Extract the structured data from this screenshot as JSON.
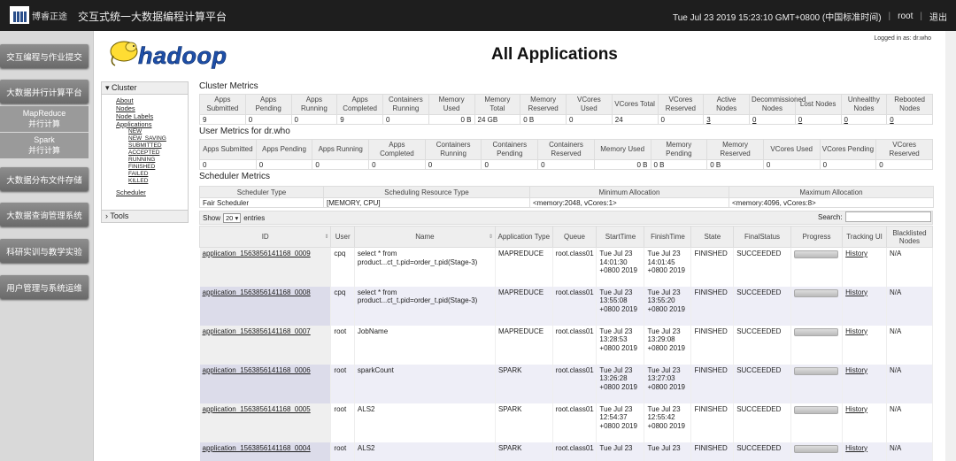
{
  "topbar": {
    "logo_text": "博睿正途",
    "system_title": "交互式统一大数据编程计算平台",
    "datetime": "Tue Jul 23 2019 15:23:10 GMT+0800 (中国标准时间)",
    "user": "root",
    "logout": "退出"
  },
  "sidenav": {
    "items": [
      {
        "label": "交互编程与作业提交"
      },
      {
        "label": "大数据并行计算平台"
      },
      {
        "label": "大数据分布文件存储"
      },
      {
        "label": "大数据查询管理系统"
      },
      {
        "label": "科研实训与教学实验"
      },
      {
        "label": "用户管理与系统运维"
      }
    ],
    "sub": [
      {
        "line1": "MapReduce",
        "line2": "并行计算"
      },
      {
        "line1": "Spark",
        "line2": "并行计算"
      }
    ]
  },
  "header": {
    "logo_alt": "hadoop",
    "title": "All Applications",
    "logged_in": "Logged in as: dr.who"
  },
  "menu": {
    "cluster": "Cluster",
    "links": [
      "About",
      "Nodes",
      "Node Labels",
      "Applications"
    ],
    "states": [
      "NEW",
      "NEW_SAVING",
      "SUBMITTED",
      "ACCEPTED",
      "RUNNING",
      "FINISHED",
      "FAILED",
      "KILLED"
    ],
    "scheduler": "Scheduler",
    "tools": "Tools"
  },
  "cluster_metrics": {
    "title": "Cluster Metrics",
    "headers": [
      "Apps Submitted",
      "Apps Pending",
      "Apps Running",
      "Apps Completed",
      "Containers Running",
      "Memory Used",
      "Memory Total",
      "Memory Reserved",
      "VCores Used",
      "VCores Total",
      "VCores Reserved",
      "Active Nodes",
      "Decommissioned Nodes",
      "Lost Nodes",
      "Unhealthy Nodes",
      "Rebooted Nodes"
    ],
    "values": [
      "9",
      "0",
      "0",
      "9",
      "0",
      "0 B",
      "24 GB",
      "0 B",
      "0",
      "24",
      "0",
      "3",
      "0",
      "0",
      "0",
      "0"
    ]
  },
  "user_metrics": {
    "title": "User Metrics for dr.who",
    "headers": [
      "Apps Submitted",
      "Apps Pending",
      "Apps Running",
      "Apps Completed",
      "Containers Running",
      "Containers Pending",
      "Containers Reserved",
      "Memory Used",
      "Memory Pending",
      "Memory Reserved",
      "VCores Used",
      "VCores Pending",
      "VCores Reserved"
    ],
    "values": [
      "0",
      "0",
      "0",
      "0",
      "0",
      "0",
      "0",
      "0 B",
      "0 B",
      "0 B",
      "0",
      "0",
      "0"
    ]
  },
  "scheduler_metrics": {
    "title": "Scheduler Metrics",
    "headers": [
      "Scheduler Type",
      "Scheduling Resource Type",
      "Minimum Allocation",
      "Maximum Allocation"
    ],
    "values": [
      "Fair Scheduler",
      "[MEMORY, CPU]",
      "<memory:2048, vCores:1>",
      "<memory:4096, vCores:8>"
    ]
  },
  "table_controls": {
    "show": "Show",
    "entries_value": "20",
    "entries": "entries",
    "search": "Search:"
  },
  "apps": {
    "headers": [
      "ID",
      "User",
      "Name",
      "Application Type",
      "Queue",
      "StartTime",
      "FinishTime",
      "State",
      "FinalStatus",
      "Progress",
      "Tracking UI",
      "Blacklisted Nodes"
    ],
    "rows": [
      {
        "id": "application_1563856141168_0009",
        "user": "cpq",
        "name": "select * from product...ct_t.pid=order_t.pid(Stage-3)",
        "type": "MAPREDUCE",
        "queue": "root.class01",
        "start": "Tue Jul 23 14:01:30 +0800 2019",
        "finish": "Tue Jul 23 14:01:45 +0800 2019",
        "state": "FINISHED",
        "final": "SUCCEEDED",
        "progress": 1.0,
        "tracking": "History",
        "blacklisted": "N/A"
      },
      {
        "id": "application_1563856141168_0008",
        "user": "cpq",
        "name": "select * from product...ct_t.pid=order_t.pid(Stage-3)",
        "type": "MAPREDUCE",
        "queue": "root.class01",
        "start": "Tue Jul 23 13:55:08 +0800 2019",
        "finish": "Tue Jul 23 13:55:20 +0800 2019",
        "state": "FINISHED",
        "final": "SUCCEEDED",
        "progress": 1.0,
        "tracking": "History",
        "blacklisted": "N/A"
      },
      {
        "id": "application_1563856141168_0007",
        "user": "root",
        "name": "JobName",
        "type": "MAPREDUCE",
        "queue": "root.class01",
        "start": "Tue Jul 23 13:28:53 +0800 2019",
        "finish": "Tue Jul 23 13:29:08 +0800 2019",
        "state": "FINISHED",
        "final": "SUCCEEDED",
        "progress": 1.0,
        "tracking": "History",
        "blacklisted": "N/A"
      },
      {
        "id": "application_1563856141168_0006",
        "user": "root",
        "name": "sparkCount",
        "type": "SPARK",
        "queue": "root.class01",
        "start": "Tue Jul 23 13:26:28 +0800 2019",
        "finish": "Tue Jul 23 13:27:03 +0800 2019",
        "state": "FINISHED",
        "final": "SUCCEEDED",
        "progress": 1.0,
        "tracking": "History",
        "blacklisted": "N/A"
      },
      {
        "id": "application_1563856141168_0005",
        "user": "root",
        "name": "ALS2",
        "type": "SPARK",
        "queue": "root.class01",
        "start": "Tue Jul 23 12:54:37 +0800 2019",
        "finish": "Tue Jul 23 12:55:42 +0800 2019",
        "state": "FINISHED",
        "final": "SUCCEEDED",
        "progress": 1.0,
        "tracking": "History",
        "blacklisted": "N/A"
      },
      {
        "id": "application_1563856141168_0004",
        "user": "root",
        "name": "ALS2",
        "type": "SPARK",
        "queue": "root.class01",
        "start": "Tue Jul 23",
        "finish": "Tue Jul 23",
        "state": "FINISHED",
        "final": "SUCCEEDED",
        "progress": 1.0,
        "tracking": "History",
        "blacklisted": "N/A"
      }
    ]
  }
}
